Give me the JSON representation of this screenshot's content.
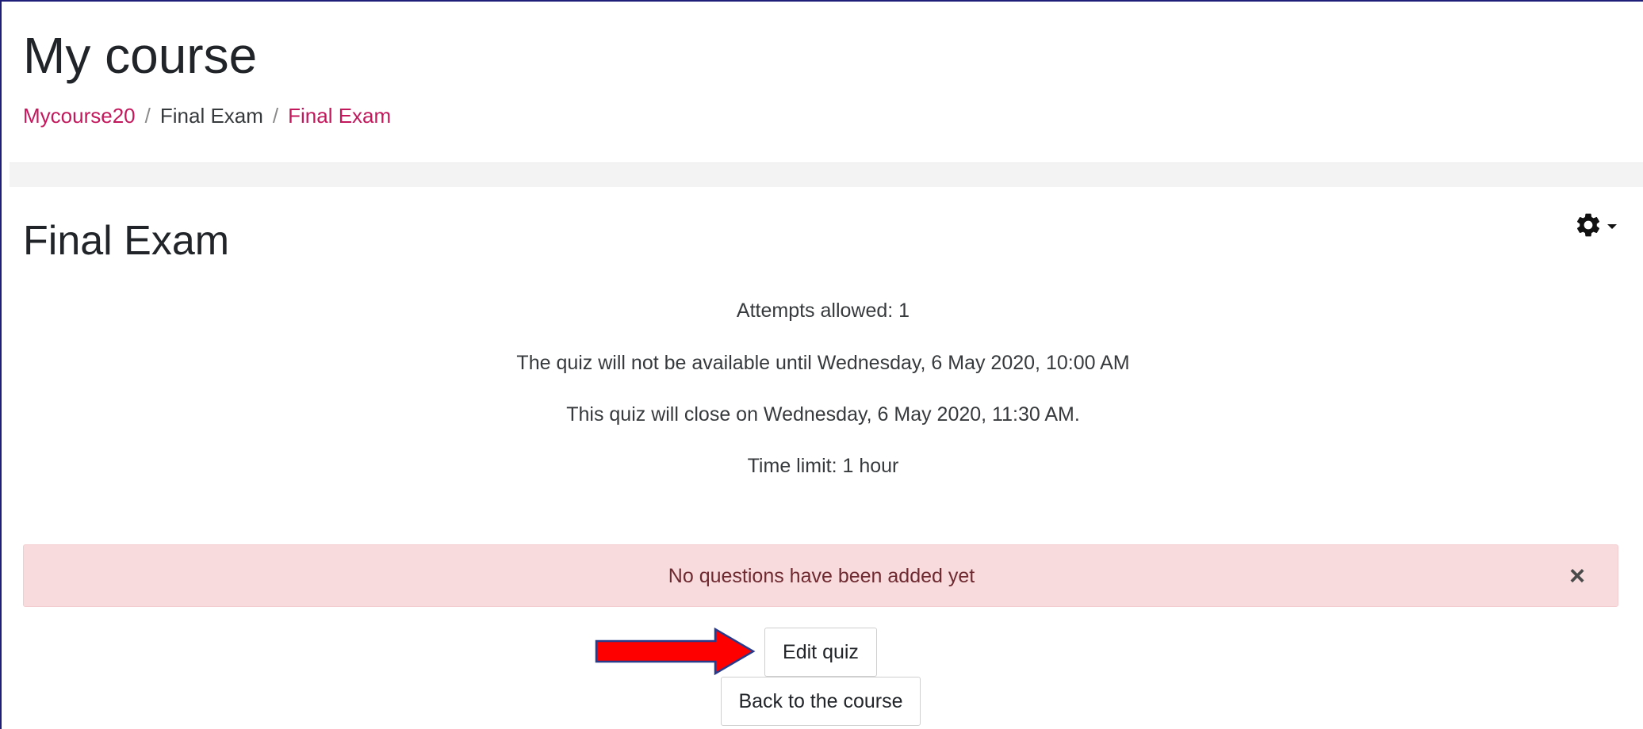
{
  "header": {
    "course_title": "My course",
    "breadcrumb": [
      {
        "label": "Mycourse20",
        "link": true
      },
      {
        "label": "Final Exam",
        "link": false
      },
      {
        "label": "Final Exam",
        "link": true
      }
    ],
    "separator": "/"
  },
  "main": {
    "title": "Final Exam",
    "settings_icon": "gear-icon",
    "info": {
      "attempts": "Attempts allowed: 1",
      "open": "The quiz will not be available until Wednesday, 6 May 2020, 10:00 AM",
      "close": "This quiz will close on Wednesday, 6 May 2020, 11:30 AM.",
      "time_limit": "Time limit: 1 hour"
    },
    "alert": {
      "message": "No questions have been added yet",
      "close_glyph": "×"
    },
    "buttons": {
      "edit_quiz": "Edit quiz",
      "back_to_course": "Back to the course"
    }
  },
  "colors": {
    "link": "#c4185c",
    "alert_bg": "#f7dbdd",
    "alert_text": "#6e2a30",
    "arrow_fill": "#ff0000",
    "arrow_stroke": "#2a3a8a"
  }
}
